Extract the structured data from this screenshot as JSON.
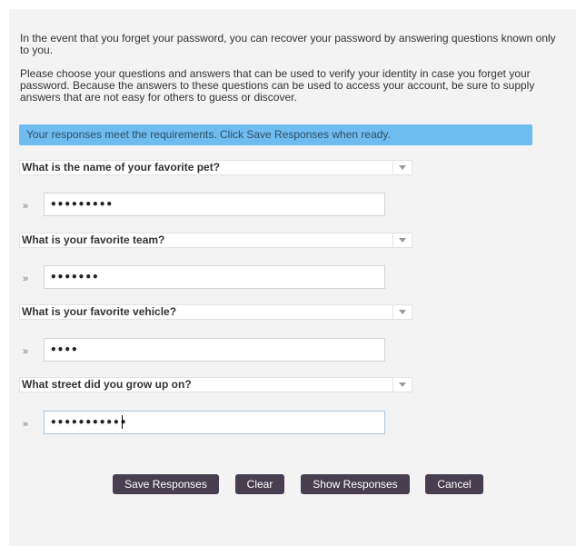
{
  "intro": {
    "recover_text": "In the event that you forget your password, you can recover your password by answering questions known only to you.",
    "choose_text": "Please choose your questions and answers that can be used to verify your identity in case you forget your password. Because the answers to these questions can be used to access your account, be sure to supply answers that are not easy for others to guess or discover."
  },
  "status_message": "Your responses meet the requirements. Click Save Responses when ready.",
  "questions": [
    {
      "question": "What is the name of your favorite pet?",
      "answer_masked": "•••••••••"
    },
    {
      "question": "What is your favorite team?",
      "answer_masked": "•••••••"
    },
    {
      "question": "What is your favorite vehicle?",
      "answer_masked": "••••"
    },
    {
      "question": "What street did you grow up on?",
      "answer_masked": "•••••••••••"
    }
  ],
  "row_marker": "»",
  "icons": {
    "dropdown": "chevron-down-icon",
    "row_marker": "double-chevron-right-icon"
  },
  "colors": {
    "banner": "#6ebcf0",
    "button": "#473f4f",
    "panel": "#f3f3f3"
  },
  "buttons": {
    "save": "Save Responses",
    "clear": "Clear",
    "show": "Show Responses",
    "cancel": "Cancel"
  }
}
